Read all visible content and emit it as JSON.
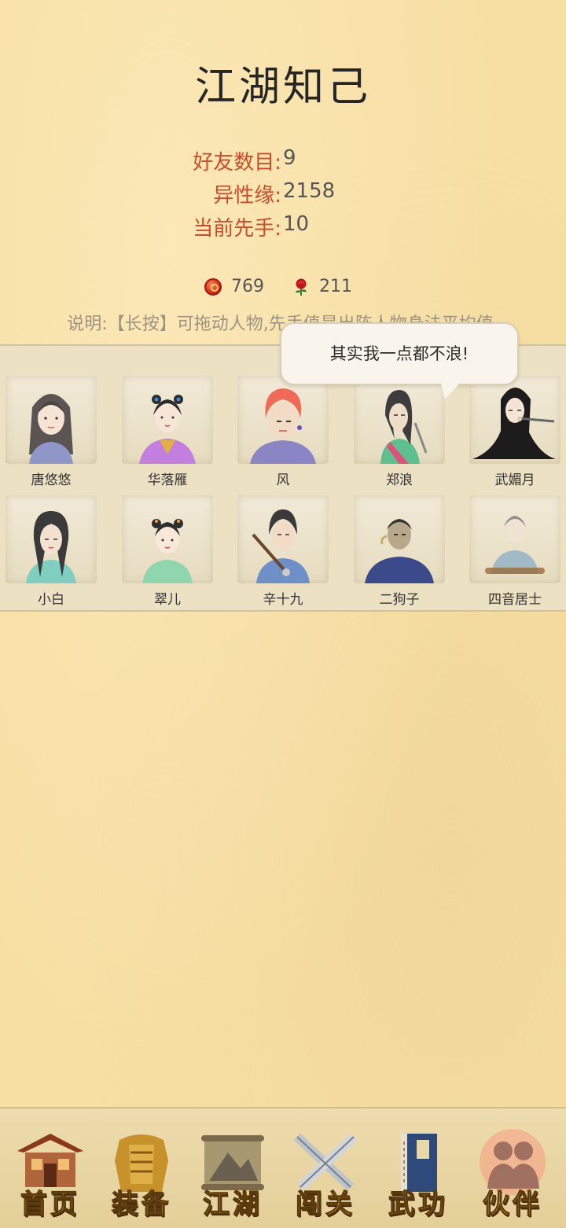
{
  "page": {
    "title": "江湖知己"
  },
  "stats": [
    {
      "label": "好友数目:",
      "value": "9"
    },
    {
      "label": "异性缘:",
      "value": "2158"
    },
    {
      "label": "当前先手:",
      "value": "10"
    }
  ],
  "currency": {
    "coin": {
      "icon": "red-coin-icon",
      "value": "769"
    },
    "rose": {
      "icon": "rose-icon",
      "value": "211"
    }
  },
  "description": "说明:【长按】可拖动人物,先手值是出阵人物身法平均值.",
  "speech_bubble": "其实我一点都不浪!",
  "characters": [
    {
      "name": "唐悠悠"
    },
    {
      "name": "华落雁"
    },
    {
      "name": "风"
    },
    {
      "name": "郑浪"
    },
    {
      "name": "武媚月"
    },
    {
      "name": "小白"
    },
    {
      "name": "翠儿"
    },
    {
      "name": "辛十九"
    },
    {
      "name": "二狗子"
    },
    {
      "name": "四音居士"
    }
  ],
  "nav": [
    {
      "label": "首页",
      "icon": "house-icon"
    },
    {
      "label": "装备",
      "icon": "armor-icon"
    },
    {
      "label": "江湖",
      "icon": "scroll-icon"
    },
    {
      "label": "闯关",
      "icon": "crossed-swords-icon"
    },
    {
      "label": "武功",
      "icon": "book-icon"
    },
    {
      "label": "伙伴",
      "icon": "companions-icon",
      "active": true
    }
  ]
}
